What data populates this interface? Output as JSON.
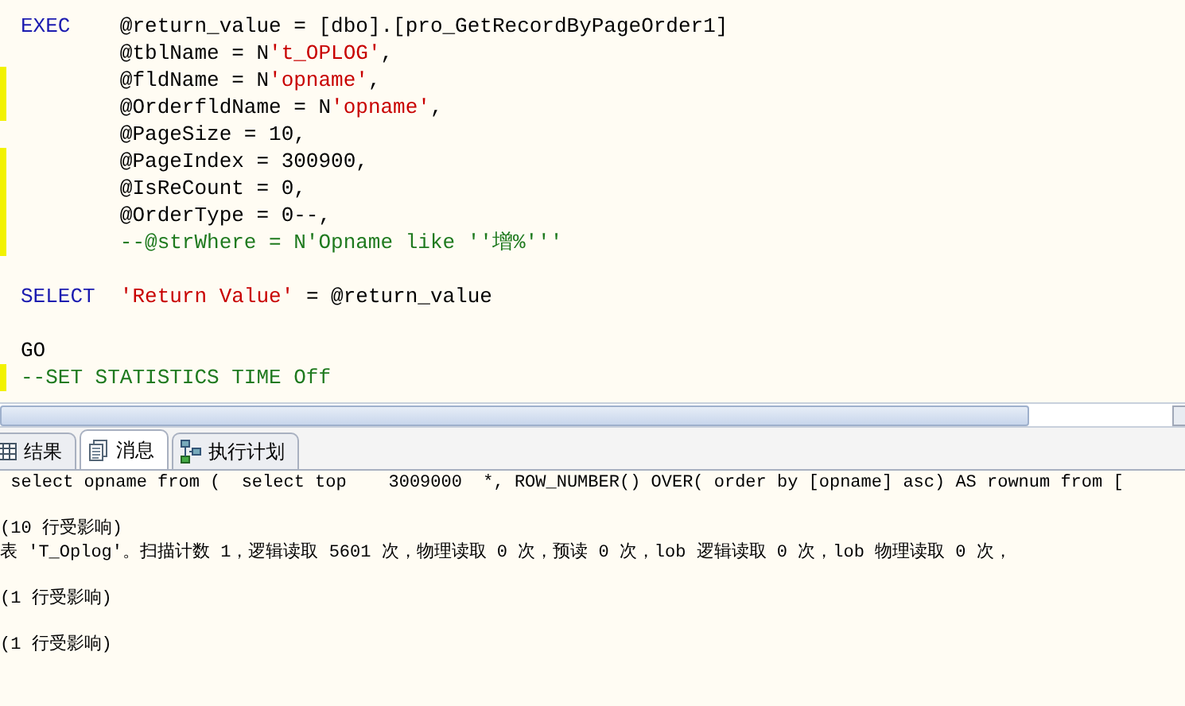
{
  "editor": {
    "blocks": [
      [
        {
          "changed": false,
          "tokens": [
            {
              "kind": "keyword",
              "text": "EXEC"
            },
            {
              "kind": "plain",
              "text": "    @return_value = [dbo].[pro_GetRecordByPageOrder1]"
            }
          ]
        },
        {
          "changed": false,
          "tokens": [
            {
              "kind": "plain",
              "text": "        @tblName = N"
            },
            {
              "kind": "string",
              "text": "'t_OPLOG'"
            },
            {
              "kind": "plain",
              "text": ","
            }
          ]
        },
        {
          "changed": true,
          "tokens": [
            {
              "kind": "plain",
              "text": "        @fldName = N"
            },
            {
              "kind": "string",
              "text": "'opname'"
            },
            {
              "kind": "plain",
              "text": ","
            }
          ]
        },
        {
          "changed": true,
          "tokens": [
            {
              "kind": "plain",
              "text": "        @OrderfldName = N"
            },
            {
              "kind": "string",
              "text": "'opname'"
            },
            {
              "kind": "plain",
              "text": ","
            }
          ]
        },
        {
          "changed": false,
          "tokens": [
            {
              "kind": "plain",
              "text": "        @PageSize = 10,"
            }
          ]
        },
        {
          "changed": true,
          "tokens": [
            {
              "kind": "plain",
              "text": "        @PageIndex = 300900,"
            }
          ]
        },
        {
          "changed": true,
          "tokens": [
            {
              "kind": "plain",
              "text": "        @IsReCount = 0,"
            }
          ]
        },
        {
          "changed": true,
          "tokens": [
            {
              "kind": "plain",
              "text": "        @OrderType = 0--,"
            }
          ]
        },
        {
          "changed": true,
          "tokens": [
            {
              "kind": "comment",
              "text": "        --@strWhere = N'Opname like ''增%'''"
            }
          ]
        }
      ],
      [
        {
          "changed": false,
          "tokens": [
            {
              "kind": "keyword",
              "text": "SELECT"
            },
            {
              "kind": "string",
              "text": "  'Return Value'"
            },
            {
              "kind": "plain",
              "text": " = @return_value"
            }
          ]
        }
      ],
      [
        {
          "changed": false,
          "tokens": [
            {
              "kind": "plain",
              "text": "GO"
            }
          ]
        },
        {
          "changed": true,
          "tokens": [
            {
              "kind": "comment",
              "text": "--SET STATISTICS TIME Off"
            }
          ]
        }
      ]
    ]
  },
  "tabs": [
    {
      "label": "结果",
      "selected": false
    },
    {
      "label": "消息",
      "selected": true
    },
    {
      "label": "执行计划",
      "selected": false
    }
  ],
  "messages": [
    [
      " select opname from (  select top    3009000  *, ROW_NUMBER() OVER( order by [opname] asc) AS rownum from ["
    ],
    [
      "(10 行受影响)",
      "表 'T_Oplog'。扫描计数 1，逻辑读取 5601 次，物理读取 0 次，预读 0 次，lob 逻辑读取 0 次，lob 物理读取 0 次，"
    ],
    [
      "(1 行受影响)"
    ],
    [
      "(1 行受影响)"
    ]
  ]
}
